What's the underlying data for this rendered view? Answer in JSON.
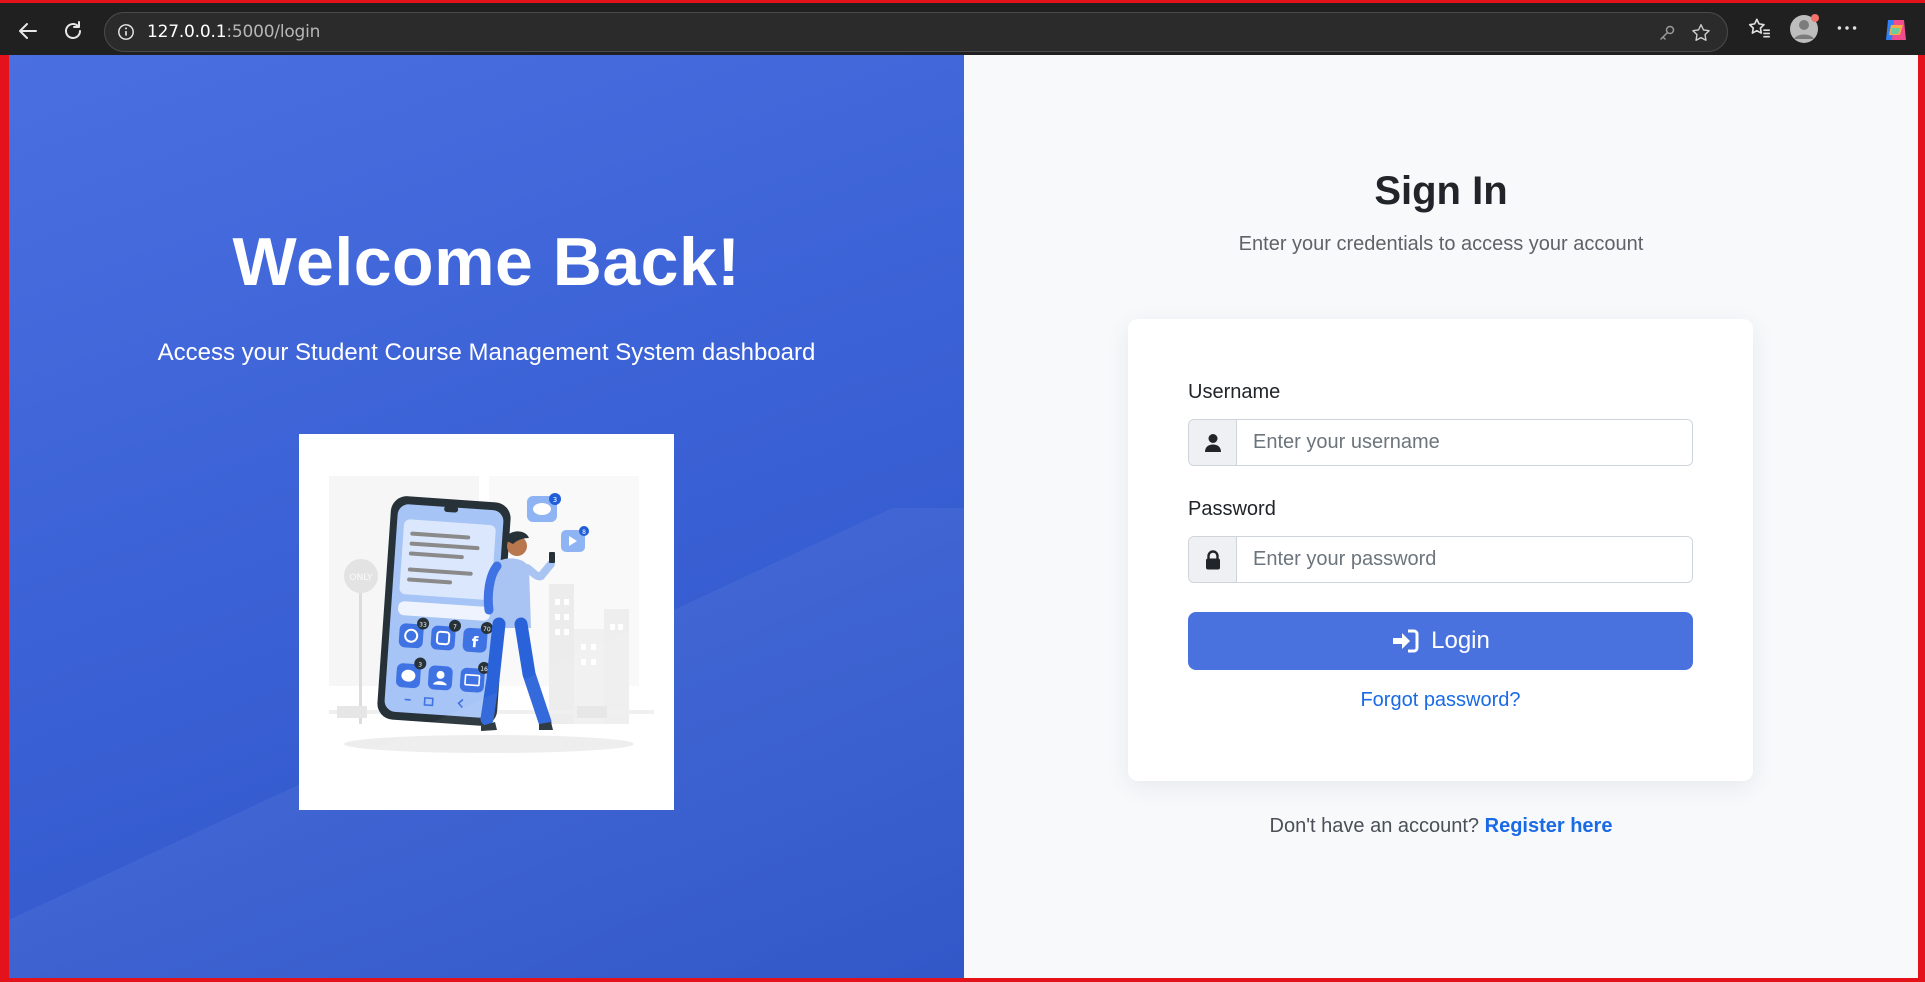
{
  "browser": {
    "url_host": "127.0.0.1",
    "url_path": ":5000/login"
  },
  "left": {
    "heading": "Welcome Back!",
    "subheading": "Access your Student Course Management System dashboard"
  },
  "signin": {
    "title": "Sign In",
    "subtitle": "Enter your credentials to access your account",
    "username_label": "Username",
    "username_placeholder": "Enter your username",
    "password_label": "Password",
    "password_placeholder": "Enter your password",
    "login_label": "Login",
    "forgot_label": "Forgot password?",
    "register_prompt": "Don't have an account?",
    "register_link": "Register here"
  },
  "illustration": {
    "badges": [
      "3",
      "8",
      "33",
      "7",
      "70",
      "3",
      "16"
    ]
  },
  "colors": {
    "primary": "#4a72de",
    "link": "#1a6ae6",
    "panel_gradient_start": "#4a6fe0",
    "panel_gradient_end": "#2e54c7"
  },
  "icons": {
    "back": "arrow-left-icon",
    "reload": "reload-icon",
    "site_info": "info-icon",
    "key": "key-icon",
    "favorite": "star-icon",
    "favorites_bar": "favorites-icon",
    "profile": "profile-icon",
    "more": "more-icon",
    "copilot": "copilot-icon",
    "user": "user-icon",
    "lock": "lock-icon",
    "login": "sign-in-icon"
  }
}
